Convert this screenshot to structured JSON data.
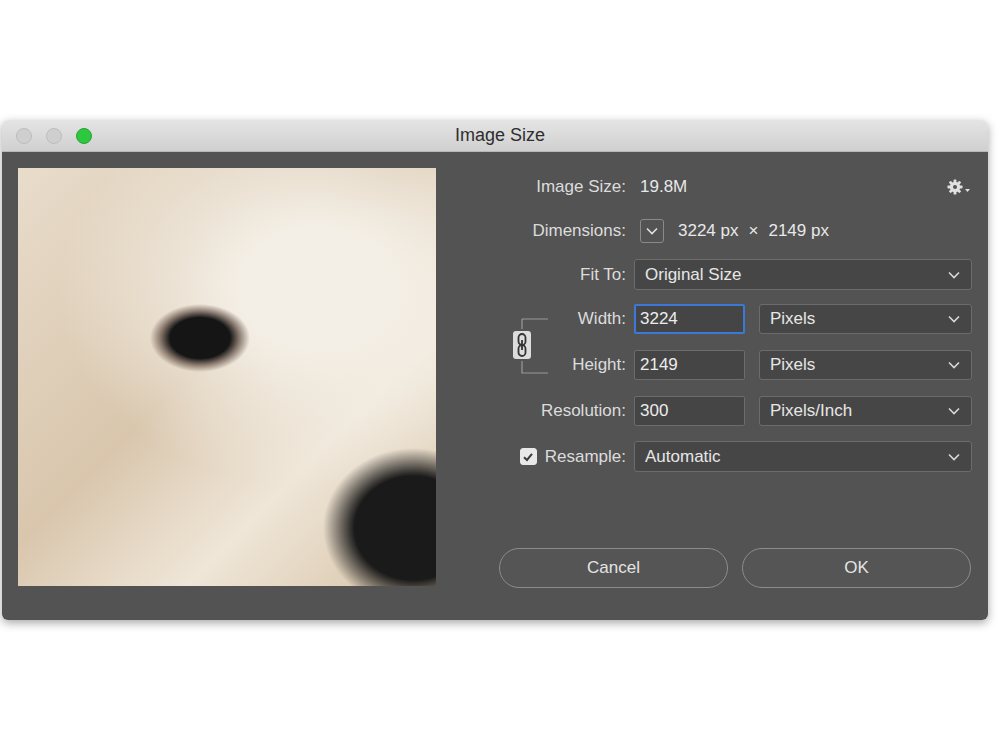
{
  "window": {
    "title": "Image Size"
  },
  "image_size": {
    "label": "Image Size:",
    "value": "19.8M"
  },
  "dimensions": {
    "label": "Dimensions:",
    "width": "3224 px",
    "separator": "×",
    "height": "2149 px"
  },
  "fit_to": {
    "label": "Fit To:",
    "value": "Original Size"
  },
  "constrain_proportions": {
    "linked": true
  },
  "fields": [
    {
      "label": "Width:",
      "value": "3224",
      "unit": "Pixels",
      "focused": true
    },
    {
      "label": "Height:",
      "value": "2149",
      "unit": "Pixels",
      "focused": false
    },
    {
      "label": "Resolution:",
      "value": "300",
      "unit": "Pixels/Inch",
      "focused": false
    }
  ],
  "resample": {
    "label": "Resample:",
    "checked": true,
    "value": "Automatic"
  },
  "buttons": [
    "Cancel",
    "OK"
  ]
}
